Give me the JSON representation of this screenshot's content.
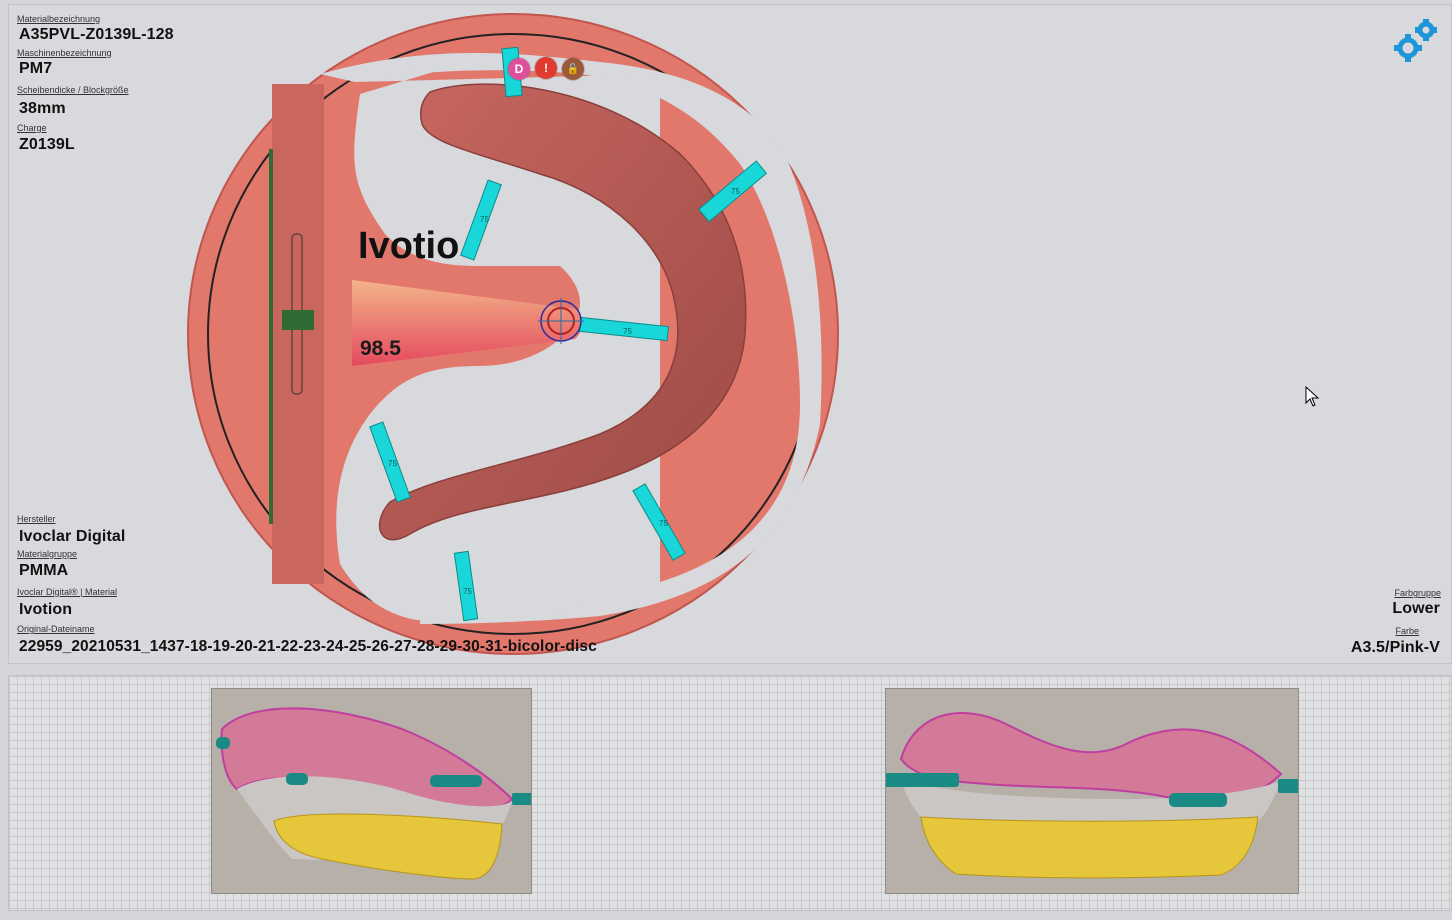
{
  "info_left_top": [
    {
      "label": "Materialbezeichnung",
      "value": "A35PVL-Z0139L-128"
    },
    {
      "label": "Maschinenbezeichnung",
      "value": "PM7"
    },
    {
      "label": "Scheibendicke / Blockgröße",
      "value": "38mm"
    },
    {
      "label": "Charge",
      "value": "Z0139L"
    }
  ],
  "info_left_bottom": [
    {
      "label": "Hersteller",
      "value": "Ivoclar Digital"
    },
    {
      "label": "Materialgruppe",
      "value": "PMMA"
    },
    {
      "label": "Ivoclar Digital® | Material",
      "value": "Ivotion"
    },
    {
      "label": "Original-Dateiname",
      "value": "22959_20210531_1437-18-19-20-21-22-23-24-25-26-27-28-29-30-31-bicolor-disc"
    }
  ],
  "info_right_bottom": [
    {
      "label": "Farbgruppe",
      "value": "Lower"
    },
    {
      "label": "Farbe",
      "value": "A3.5/Pink-V"
    }
  ],
  "disc": {
    "brand_text": "Ivotio",
    "height_value": "98.5",
    "connector_label": "75",
    "badges": [
      "D",
      "!",
      "🔓"
    ]
  },
  "colors": {
    "disc_fill": "#e2776c",
    "denture": "#b85a54",
    "connector": "#19d6d8",
    "badge_d": "#e0509a",
    "badge_warn": "#e03b2e",
    "badge_lock": "#9a5a3a",
    "gear": "#1c96d8"
  },
  "icons": {
    "settings": "gear-icon",
    "cursor": "mouse-pointer-icon",
    "tool": "milling-tool-icon"
  }
}
